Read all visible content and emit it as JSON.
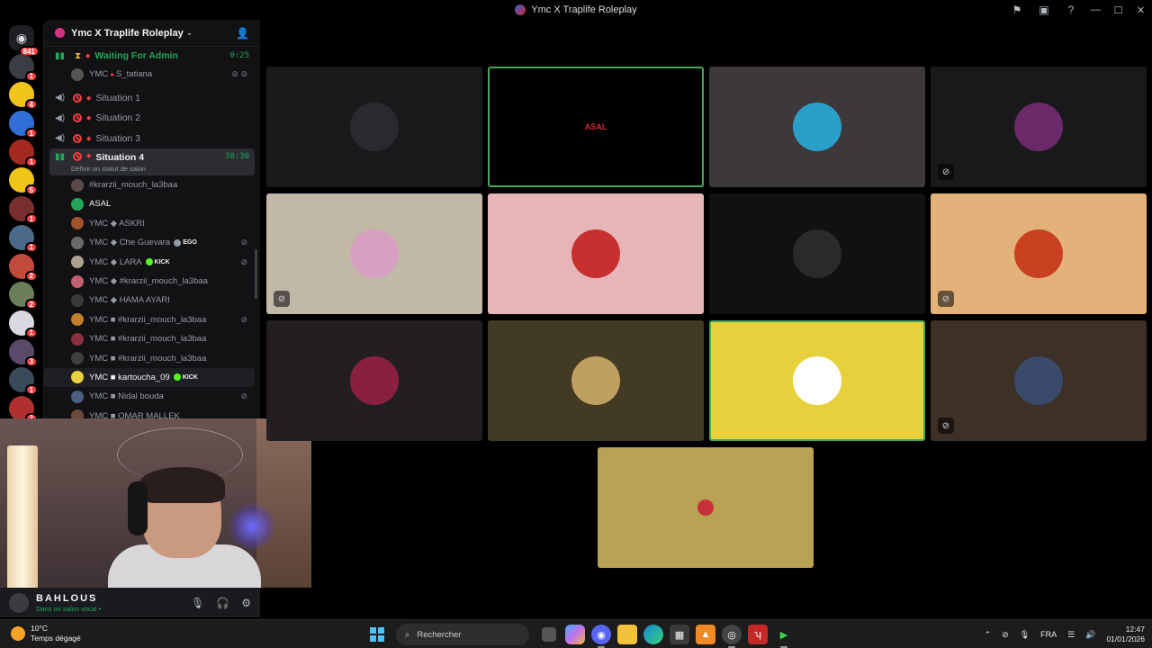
{
  "window": {
    "title": "Ymc X Traplife Roleplay"
  },
  "rail": {
    "home_badge": "841",
    "servers": [
      {
        "badge": "1",
        "color": "#3a3d44"
      },
      {
        "badge": "4",
        "color": "#f0c419"
      },
      {
        "badge": "1",
        "color": "#2f6fd6"
      },
      {
        "badge": "1",
        "color": "#a3281e"
      },
      {
        "badge": "5",
        "color": "#f0c419"
      },
      {
        "badge": "1",
        "color": "#7a2f2f"
      },
      {
        "badge": "1",
        "color": "#4b6a8a"
      },
      {
        "badge": "2",
        "color": "#c24a3a"
      },
      {
        "badge": "2",
        "color": "#6a7f5a"
      },
      {
        "badge": "1",
        "color": "#d8d8e0"
      },
      {
        "badge": "3",
        "color": "#5a4a6a"
      },
      {
        "badge": "1",
        "color": "#3a4a5a"
      },
      {
        "badge": "2",
        "color": "#b03030"
      }
    ]
  },
  "guild": {
    "name": "Ymc X Traplife Roleplay"
  },
  "channels": {
    "waiting": {
      "name": "Waiting For Admin",
      "time": "0:25"
    },
    "waiting_member": {
      "prefix": "YMC",
      "name": "S_tatiana"
    },
    "s1": "Situation 1",
    "s2": "Situation 2",
    "s3": "Situation 3",
    "s4": {
      "name": "Situation 4",
      "time": "38:30",
      "status": "Définir un statut de salon"
    }
  },
  "members": [
    {
      "text": "#krarzii_mouch_la3baa",
      "color": "#5a4a4a"
    },
    {
      "text": "ASAL",
      "color": "#23a55a"
    },
    {
      "text": "YMC ◆ ASKRI",
      "color": "#a0522d"
    },
    {
      "text": "YMC ◆ Che Guevara",
      "tag": "EGO",
      "color": "#6a6a6a"
    },
    {
      "text": "YMC ◆ LARA",
      "tag": "KICK",
      "color": "#b0a090"
    },
    {
      "text": "YMC ◆ #krarzii_mouch_la3baa",
      "color": "#c06070"
    },
    {
      "text": "YMC ◆ HAMA AYARI",
      "color": "#3a3a3a"
    },
    {
      "text": "YMC ■ #krarzii_mouch_la3baa",
      "color": "#c08030"
    },
    {
      "text": "YMC ■ #krarzii_mouch_la3baa",
      "color": "#8a3040"
    },
    {
      "text": "YMC ■ #krarzii_mouch_la3baa",
      "color": "#404040"
    },
    {
      "text": "YMC ■ kartoucha_09",
      "tag": "KICK",
      "color": "#e8d040"
    },
    {
      "text": "YMC ■ Nidal bouda",
      "color": "#4a6080"
    },
    {
      "text": "YMC ■ OMAR MALLEK",
      "color": "#6a4a3a"
    }
  ],
  "user": {
    "name": "BAHLOUS",
    "status": "Dans un salon vocal • "
  },
  "tiles": [
    {
      "bg": "#1a1a1c",
      "av": "#2a2a2e",
      "label": "",
      "muted": false,
      "speaking": false
    },
    {
      "bg": "#000000",
      "av": "#000000",
      "label": "ASAL",
      "muted": false,
      "speaking": true
    },
    {
      "bg": "#3d3839",
      "av": "#2aa0c8",
      "label": "",
      "muted": false,
      "speaking": false
    },
    {
      "bg": "#19191b",
      "av": "#6a2a6a",
      "label": "",
      "muted": true,
      "speaking": false
    },
    {
      "bg": "#c1b8a8",
      "av": "#d8a0c0",
      "label": "",
      "muted": true,
      "speaking": false
    },
    {
      "bg": "#e6b5b8",
      "av": "#c83030",
      "label": "",
      "muted": false,
      "speaking": false
    },
    {
      "bg": "#111111",
      "av": "#2a2a2a",
      "label": "",
      "muted": false,
      "speaking": false
    },
    {
      "bg": "#e2b27a",
      "av": "#c84020",
      "label": "",
      "muted": true,
      "speaking": false
    },
    {
      "bg": "#221e22",
      "av": "#8a2040",
      "label": "",
      "muted": false,
      "speaking": false
    },
    {
      "bg": "#433a24",
      "av": "#c0a060",
      "label": "",
      "muted": false,
      "speaking": false
    },
    {
      "bg": "#e6d03c",
      "av": "#ffffff",
      "label": "",
      "muted": false,
      "speaking": true
    },
    {
      "bg": "#3d3027",
      "av": "#3a4a6a",
      "label": "",
      "muted": true,
      "speaking": false
    },
    {
      "bg": "#b8a254",
      "av": "#b8a254",
      "label": "",
      "muted": false,
      "speaking": false
    }
  ],
  "taskbar": {
    "temp": "10°C",
    "weather": "Temps dégagé",
    "search_placeholder": "Rechercher",
    "lang": "FRA",
    "time": "12:47",
    "date": "01/01/2026"
  }
}
